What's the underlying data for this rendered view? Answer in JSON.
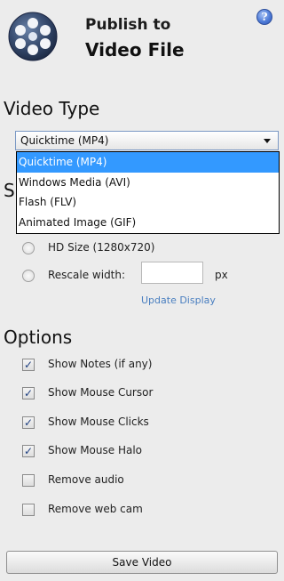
{
  "header": {
    "title_line1": "Publish to",
    "title_line2": "Video File",
    "help_symbol": "?"
  },
  "video_type": {
    "heading": "Video Type",
    "selected": "Quicktime (MP4)",
    "options": [
      "Quicktime (MP4)",
      "Windows Media (AVI)",
      "Flash (FLV)",
      "Animated Image (GIF)"
    ]
  },
  "size": {
    "heading_visible_fragment": "S",
    "hd_label": "HD Size (1280x720)",
    "rescale_label": "Rescale width:",
    "rescale_value": "",
    "unit": "px",
    "update_link": "Update Display"
  },
  "options": {
    "heading": "Options",
    "items": [
      {
        "label": "Show Notes (if any)",
        "checked": true
      },
      {
        "label": "Show Mouse Cursor",
        "checked": true
      },
      {
        "label": "Show Mouse Clicks",
        "checked": true
      },
      {
        "label": "Show Mouse Halo",
        "checked": true
      },
      {
        "label": "Remove audio",
        "checked": false
      },
      {
        "label": "Remove web cam",
        "checked": false
      }
    ]
  },
  "actions": {
    "save_label": "Save Video"
  }
}
